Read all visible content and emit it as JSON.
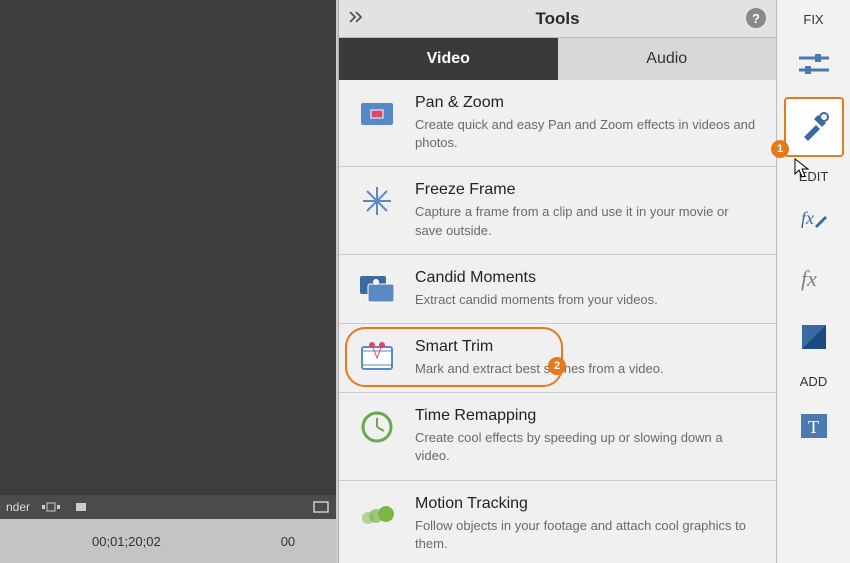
{
  "panel": {
    "title": "Tools",
    "tabs": {
      "video": "Video",
      "audio": "Audio"
    }
  },
  "tools": [
    {
      "title": "Pan & Zoom",
      "desc": "Create quick and easy Pan and Zoom effects in videos and photos."
    },
    {
      "title": "Freeze Frame",
      "desc": "Capture a frame from a clip and use it in your movie or save outside."
    },
    {
      "title": "Candid Moments",
      "desc": "Extract candid moments from your videos."
    },
    {
      "title": "Smart Trim",
      "desc": "Mark and extract best scenes from a video."
    },
    {
      "title": "Time Remapping",
      "desc": "Create cool effects by speeding up or slowing down a video."
    },
    {
      "title": "Motion Tracking",
      "desc": "Follow objects in your footage and attach cool graphics to them."
    }
  ],
  "rail": {
    "fix": "FIX",
    "edit": "EDIT",
    "add": "ADD"
  },
  "controls": {
    "render": "nder",
    "timecode": "00;01;20;02",
    "timecode2": "00"
  },
  "callouts": {
    "one": "1",
    "two": "2"
  }
}
